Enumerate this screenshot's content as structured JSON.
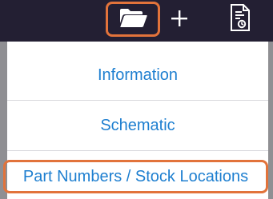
{
  "toolbar": {
    "icons": [
      "folder-open-icon",
      "plus-icon",
      "document-settings-icon"
    ],
    "background": "#231f33",
    "highlight_color": "#e2733b"
  },
  "menu": {
    "items": [
      {
        "label": "Information"
      },
      {
        "label": "Schematic"
      },
      {
        "label": "Part Numbers / Stock Locations"
      }
    ],
    "text_color": "#1e7fd0"
  }
}
